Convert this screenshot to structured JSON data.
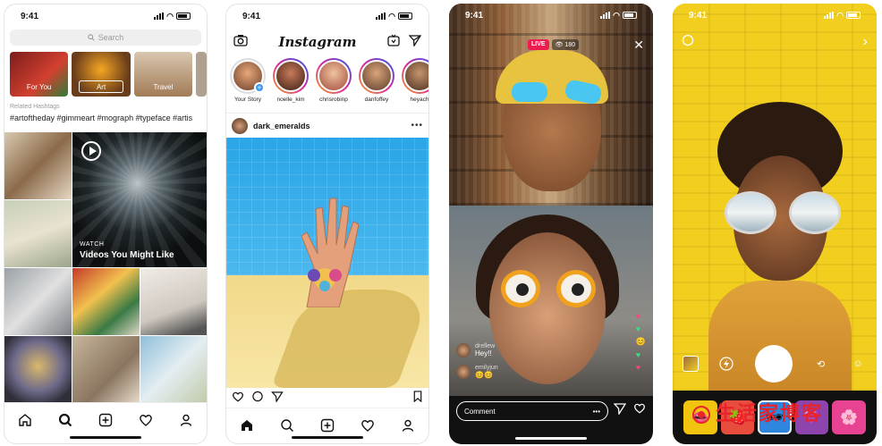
{
  "status": {
    "time": "9:41"
  },
  "explore": {
    "search_placeholder": "Search",
    "categories": [
      "For You",
      "Art",
      "Travel"
    ],
    "related_label": "Related Hashtags",
    "hashtags": "#artoftheday #gimmeart #mograph #typeface #artis",
    "video_kicker": "WATCH",
    "video_title": "Videos You Might Like"
  },
  "feed": {
    "logo": "Instagram",
    "stories": [
      "Your Story",
      "noelle_kim",
      "chrisrobinp",
      "danfoffey",
      "heyach"
    ],
    "post_user": "dark_emeralds"
  },
  "live": {
    "badge": "LIVE",
    "viewers": "180",
    "comments": [
      {
        "user": "drellew",
        "text": "Hey!!"
      },
      {
        "user": "emilyjun",
        "text": "😊😊"
      }
    ],
    "comment_placeholder": "Comment"
  },
  "camera": {
    "watermark": "生活家博客"
  },
  "icons": {
    "home": "home-icon",
    "search": "search-icon",
    "add": "add-icon",
    "activity": "heart-icon",
    "profile": "profile-icon"
  },
  "colors": {
    "live_red": "#ed1d50",
    "story_gradient": "#d6249f"
  }
}
